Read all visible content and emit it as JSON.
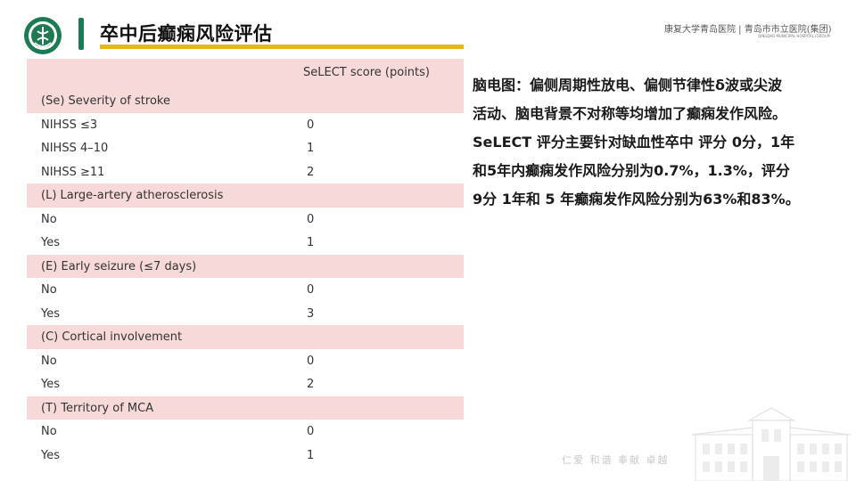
{
  "header": {
    "title": "卒中后癫痫风险评估",
    "hospital_name": "康复大学青岛医院 | 青岛市市立医院(集团)",
    "hospital_subname": "QINGDAO MUNICIPAL HOSPITAL (GROUP)"
  },
  "table": {
    "column_header": "SeLECT score (points)",
    "rows": [
      {
        "kind": "section",
        "label": "(Se) Severity of stroke",
        "value": ""
      },
      {
        "kind": "item",
        "label": "NIHSS ≤3",
        "value": "0"
      },
      {
        "kind": "item",
        "label": "NIHSS 4–10",
        "value": "1"
      },
      {
        "kind": "item",
        "label": "NIHSS ≥11",
        "value": "2"
      },
      {
        "kind": "section",
        "label": "(L) Large-artery atherosclerosis",
        "value": ""
      },
      {
        "kind": "item",
        "label": "No",
        "value": "0"
      },
      {
        "kind": "item",
        "label": "Yes",
        "value": "1"
      },
      {
        "kind": "section",
        "label": "(E) Early seizure (≤7 days)",
        "value": ""
      },
      {
        "kind": "item",
        "label": "No",
        "value": "0"
      },
      {
        "kind": "item",
        "label": "Yes",
        "value": "3"
      },
      {
        "kind": "section",
        "label": "(C) Cortical involvement",
        "value": ""
      },
      {
        "kind": "item",
        "label": "No",
        "value": "0"
      },
      {
        "kind": "item",
        "label": "Yes",
        "value": "2"
      },
      {
        "kind": "section",
        "label": "(T) Territory of MCA",
        "value": ""
      },
      {
        "kind": "item",
        "label": "No",
        "value": "0"
      },
      {
        "kind": "item",
        "label": "Yes",
        "value": "1"
      }
    ]
  },
  "description": {
    "lines": [
      "脑电图：偏侧周期性放电、偏侧节律性δ波或尖波",
      "活动、脑电背景不对称等均增加了癫痫发作风险。",
      "SeLECT 评分主要针对缺血性卒中 评分 0分，1年",
      "和5年内癫痫发作风险分别为0.7%，1.3%，评分",
      "9分 1年和 5  年癫痫发作风险分别为63%和83%。"
    ]
  },
  "footer": {
    "motto": "仁爱 和谐 奉献 卓越"
  },
  "colors": {
    "brand_green": "#1e7a52",
    "accent_yellow": "#e7b61c",
    "table_pink": "#f8d9d9"
  }
}
